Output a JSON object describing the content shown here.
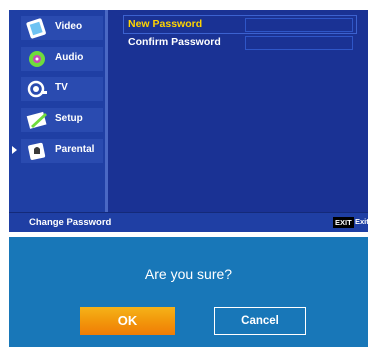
{
  "menu": {
    "items": [
      {
        "label": "Video",
        "icon": "video-icon"
      },
      {
        "label": "Audio",
        "icon": "audio-icon"
      },
      {
        "label": "TV",
        "icon": "tv-icon"
      },
      {
        "label": "Setup",
        "icon": "setup-icon"
      },
      {
        "label": "Parental",
        "icon": "parental-icon",
        "selected": true
      }
    ]
  },
  "form": {
    "new_password_label": "New Password",
    "confirm_password_label": "Confirm Password",
    "new_password_value": "",
    "confirm_password_value": ""
  },
  "status": {
    "text": "Change Password",
    "exit_key": "EXIT",
    "exit_label": "Exit"
  },
  "dialog": {
    "message": "Are you sure?",
    "ok_label": "OK",
    "cancel_label": "Cancel"
  },
  "colors": {
    "panel_blue": "#1f3fa4",
    "highlight_yellow": "#ffd400",
    "dialog_blue": "#1877b8",
    "ok_orange": "#f29a0c"
  }
}
